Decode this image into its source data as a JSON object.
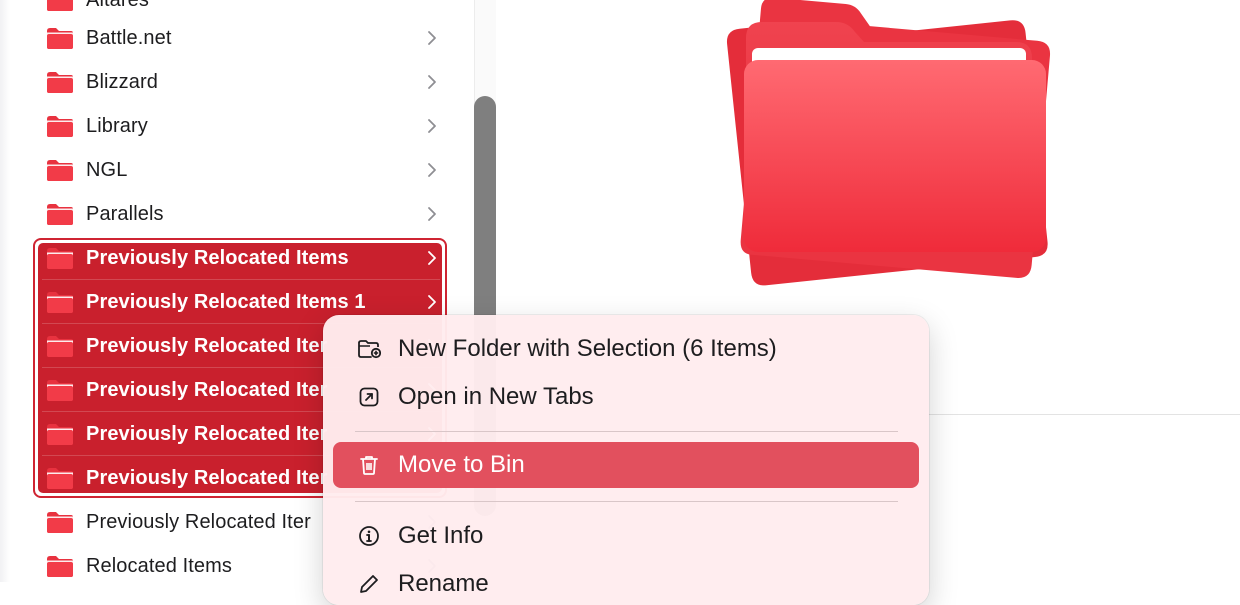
{
  "colors": {
    "folder_red": "#e8323f",
    "selection_red": "#c9202d",
    "menu_highlight": "#e2505e",
    "menu_bg": "#ffecee"
  },
  "list": {
    "partial_top_label": "Altares",
    "items": [
      {
        "label": "Battle.net",
        "selected": false
      },
      {
        "label": "Blizzard",
        "selected": false
      },
      {
        "label": "Library",
        "selected": false
      },
      {
        "label": "NGL",
        "selected": false
      },
      {
        "label": "Parallels",
        "selected": false
      },
      {
        "label": "Previously Relocated Items",
        "selected": true
      },
      {
        "label": "Previously Relocated Items 1",
        "selected": true
      },
      {
        "label": "Previously Relocated Iter",
        "selected": true
      },
      {
        "label": "Previously Relocated Iter",
        "selected": true
      },
      {
        "label": "Previously Relocated Iter",
        "selected": true
      },
      {
        "label": "Previously Relocated Iter",
        "selected": true
      },
      {
        "label": "Previously Relocated Iter",
        "selected": false
      },
      {
        "label": "Relocated Items",
        "selected": false
      }
    ]
  },
  "context_menu": {
    "items": [
      {
        "label": "New Folder with Selection (6 Items)",
        "icon": "folder-plus-icon",
        "highlighted": false
      },
      {
        "label": "Open in New Tabs",
        "icon": "open-tab-icon",
        "highlighted": false
      },
      {
        "label": "Move to Bin",
        "icon": "trash-icon",
        "highlighted": true
      },
      {
        "label": "Get Info",
        "icon": "info-icon",
        "highlighted": false
      },
      {
        "label": "Rename",
        "icon": "pencil-icon",
        "highlighted": false
      }
    ]
  }
}
